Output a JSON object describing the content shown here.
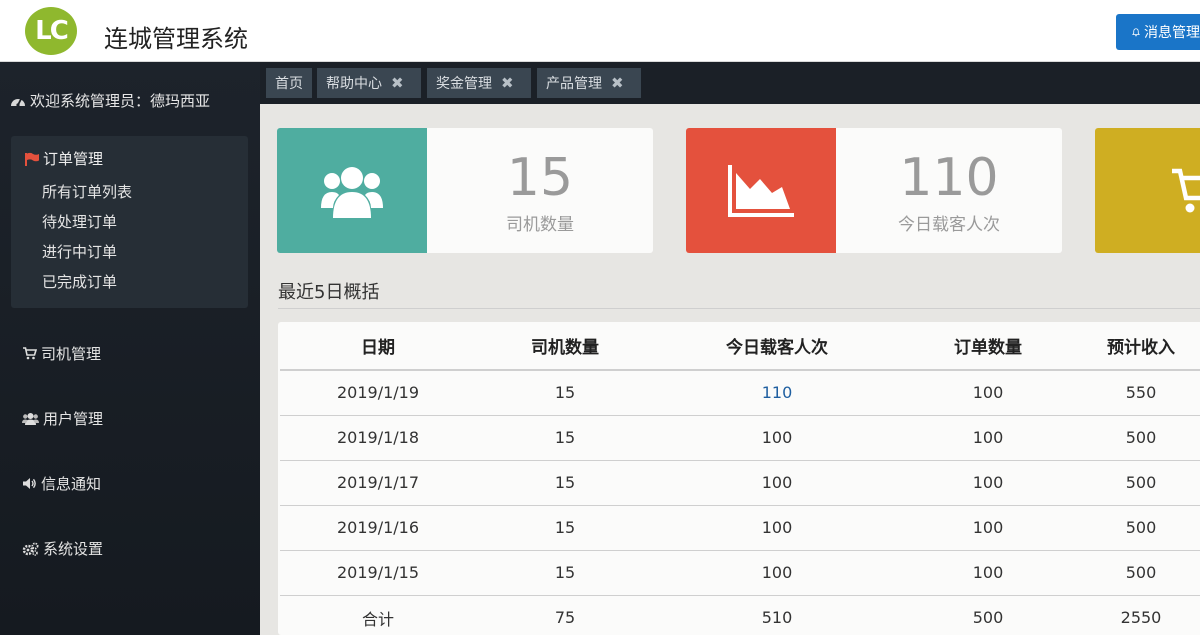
{
  "header": {
    "logo_text": "LC",
    "title": "连城管理系统",
    "message_button": "消息管理"
  },
  "sidebar": {
    "welcome": "欢迎系统管理员：德玛西亚",
    "order_group": {
      "label": "订单管理",
      "items": [
        "所有订单列表",
        "待处理订单",
        "进行中订单",
        "已完成订单"
      ]
    },
    "nav": [
      {
        "label": "司机管理",
        "icon": "cart-icon"
      },
      {
        "label": "用户管理",
        "icon": "users-icon"
      },
      {
        "label": "信息通知",
        "icon": "volume-icon"
      },
      {
        "label": "系统设置",
        "icon": "gears-icon"
      }
    ]
  },
  "tabs": [
    {
      "label": "首页",
      "closable": false
    },
    {
      "label": "帮助中心",
      "closable": true
    },
    {
      "label": "奖金管理",
      "closable": true
    },
    {
      "label": "产品管理",
      "closable": true
    }
  ],
  "close_glyph": "✖",
  "stats": [
    {
      "value": "15",
      "label": "司机数量",
      "color": "#4fada0",
      "icon": "users-icon"
    },
    {
      "value": "110",
      "label": "今日载客人次",
      "color": "#e4513d",
      "icon": "area-chart-icon"
    },
    {
      "value": "",
      "label": "",
      "color": "#cfae22",
      "icon": "cart-icon"
    }
  ],
  "summary": {
    "title": "最近5日概括",
    "columns": [
      "日期",
      "司机数量",
      "今日载客人次",
      "订单数量",
      "预计收入"
    ],
    "rows": [
      [
        "2019/1/19",
        "15",
        "110",
        "100",
        "550"
      ],
      [
        "2019/1/18",
        "15",
        "100",
        "100",
        "500"
      ],
      [
        "2019/1/17",
        "15",
        "100",
        "100",
        "500"
      ],
      [
        "2019/1/16",
        "15",
        "100",
        "100",
        "500"
      ],
      [
        "2019/1/15",
        "15",
        "100",
        "100",
        "500"
      ]
    ],
    "total": [
      "合计",
      "75",
      "510",
      "500",
      "2550"
    ]
  }
}
